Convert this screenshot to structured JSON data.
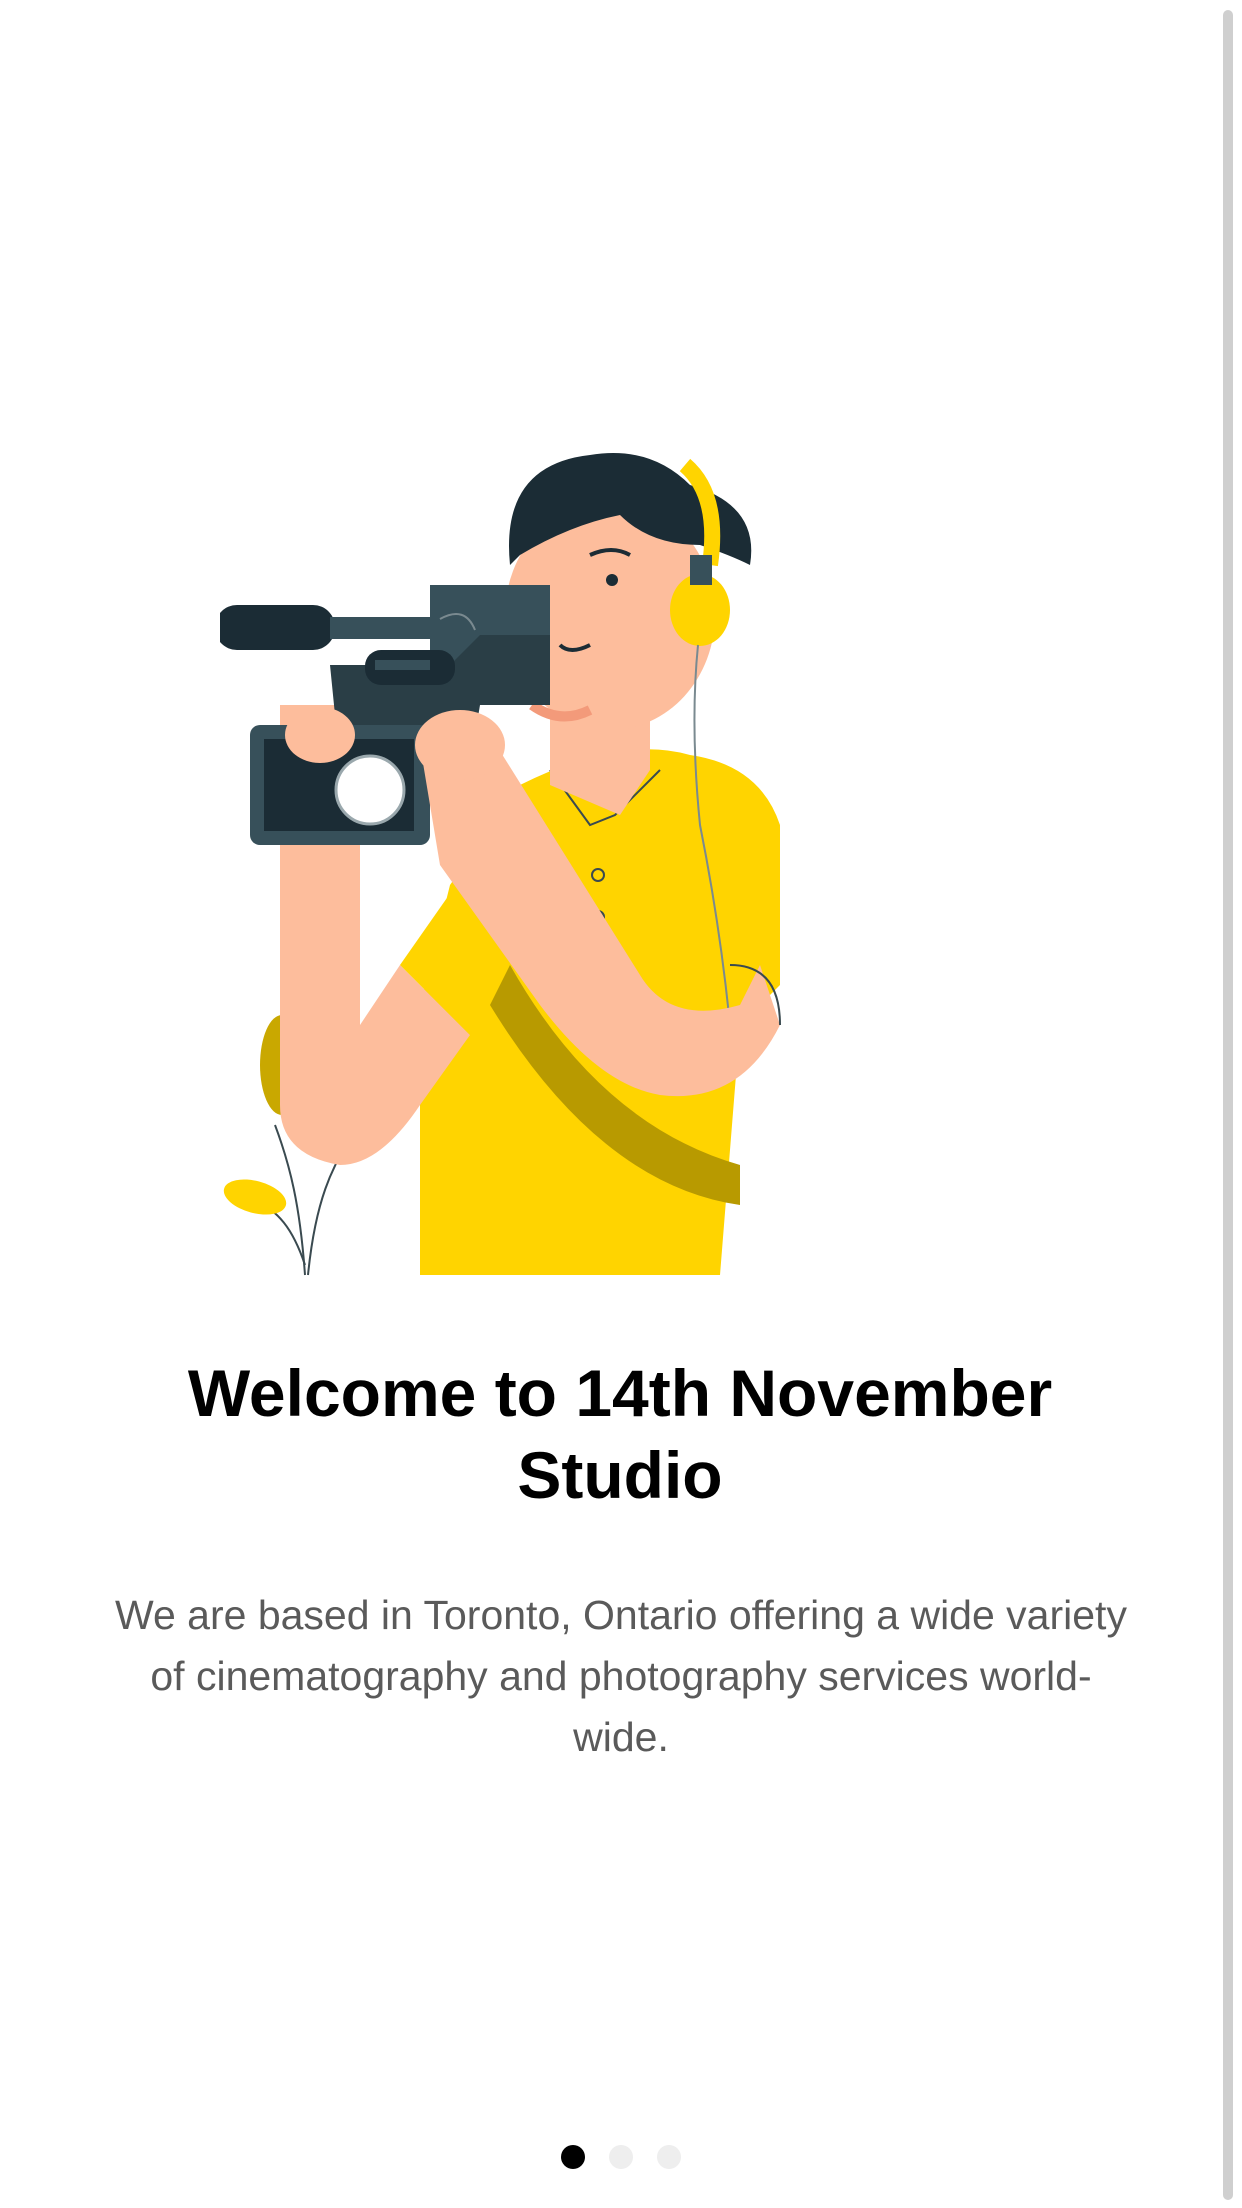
{
  "onboarding": {
    "title": "Welcome to 14th November Studio",
    "description": "We are based in Toronto, Ontario offering a wide variety of cinematography and photography services world-wide.",
    "illustration_icon": "cameraman-illustration",
    "current_page": 1,
    "total_pages": 3
  },
  "colors": {
    "accent": "#FFD400",
    "dot_active": "#000000",
    "dot_inactive": "#EEEEEE",
    "title_text": "#000000",
    "body_text": "#5A5A5A"
  }
}
